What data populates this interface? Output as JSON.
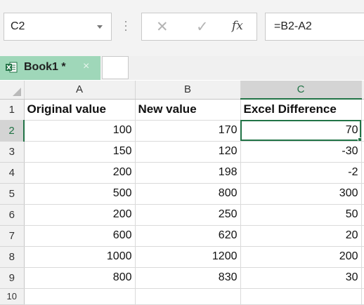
{
  "formula_bar": {
    "name_box": "C2",
    "fx_label": "fx",
    "formula": "=B2-A2"
  },
  "workbook_tab": {
    "name": "Book1 *",
    "close_glyph": "×"
  },
  "sheet": {
    "column_headers": [
      "A",
      "B",
      "C"
    ],
    "partial_row_label": "10",
    "rows": [
      {
        "row": "1",
        "cells": [
          "Original value",
          "New value",
          "Excel Difference"
        ]
      },
      {
        "row": "2",
        "cells": [
          "100",
          "170",
          "70"
        ]
      },
      {
        "row": "3",
        "cells": [
          "150",
          "120",
          "-30"
        ]
      },
      {
        "row": "4",
        "cells": [
          "200",
          "198",
          "-2"
        ]
      },
      {
        "row": "5",
        "cells": [
          "500",
          "800",
          "300"
        ]
      },
      {
        "row": "6",
        "cells": [
          "200",
          "250",
          "50"
        ]
      },
      {
        "row": "7",
        "cells": [
          "600",
          "620",
          "20"
        ]
      },
      {
        "row": "8",
        "cells": [
          "1000",
          "1200",
          "200"
        ]
      },
      {
        "row": "9",
        "cells": [
          "800",
          "830",
          "30"
        ]
      }
    ]
  },
  "colors": {
    "selection_green": "#217346",
    "tab_green": "#9fd7b9"
  }
}
